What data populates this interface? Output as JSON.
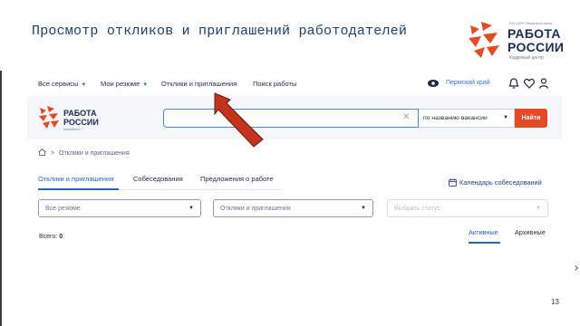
{
  "slide": {
    "title": "Просмотр откликов и приглашений работодателей",
    "page_number": "13"
  },
  "top_logo": {
    "small_caption": "ГКУ ЦЗН Пермского края",
    "line1": "РАБОТА",
    "line2": "РОССИИ",
    "subtitle": "Кадровый центр"
  },
  "nav": {
    "items": [
      {
        "label": "Все сервисы",
        "has_caret": true
      },
      {
        "label": "Мои резюме",
        "has_caret": true
      },
      {
        "label": "Отклики и приглашения",
        "has_caret": false
      },
      {
        "label": "Поиск работы",
        "has_caret": false
      }
    ],
    "region": "Пермский край",
    "icons": [
      "eye-icon",
      "bell-icon",
      "heart-icon",
      "user-icon"
    ]
  },
  "site_logo": {
    "line1": "РАБОТА",
    "line2": "РОССИИ",
    "domain": "trudvsem.ru"
  },
  "search": {
    "value": "",
    "placeholder": "",
    "mode": "по названию вакансии",
    "button": "Найти"
  },
  "breadcrumb": {
    "separator": ">",
    "current": "Отклики и приглашения"
  },
  "tabs": [
    {
      "label": "Отклики и приглашения",
      "active": true
    },
    {
      "label": "Собеседования",
      "active": false
    },
    {
      "label": "Предложения о работе",
      "active": false
    }
  ],
  "calendar_link": "Календарь собеседований",
  "filters": [
    {
      "value": "Все резюме",
      "disabled": false
    },
    {
      "value": "Отклики и приглашения",
      "disabled": false
    },
    {
      "value": "Выбрать статус",
      "disabled": true
    }
  ],
  "total": {
    "label": "Всего:",
    "count": "0"
  },
  "status_tabs": [
    {
      "label": "Активные",
      "active": true
    },
    {
      "label": "Архивные",
      "active": false
    }
  ],
  "colors": {
    "accent_blue": "#2563c7",
    "search_button": "#e24b24",
    "arrow": "#c4341c",
    "logo_red": "#e24b24",
    "logo_navy": "#1a2d55"
  }
}
